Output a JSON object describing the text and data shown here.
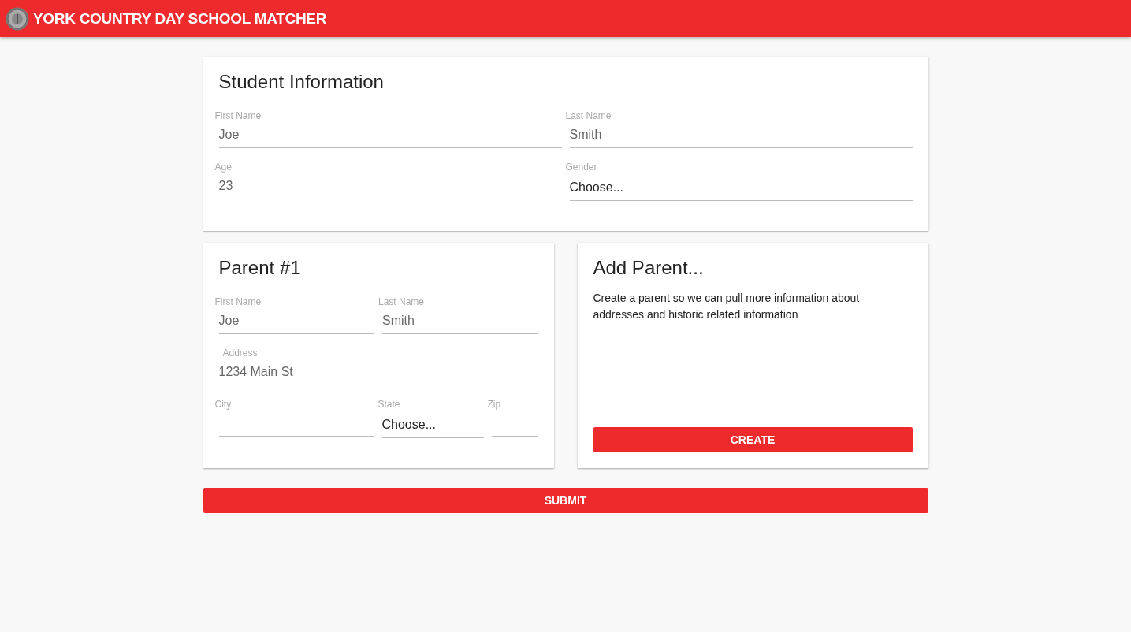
{
  "app_bar": {
    "title": "YORK COUNTRY DAY SCHOOL MATCHER"
  },
  "student": {
    "title": "Student Information",
    "rows": [
      [
        {
          "kind": "text",
          "label": "First Name",
          "value": "Joe"
        },
        {
          "kind": "text",
          "label": "Last Name",
          "value": "Smith"
        }
      ],
      [
        {
          "kind": "text",
          "label": "Age",
          "value": "23"
        },
        {
          "kind": "select",
          "label": "Gender",
          "value": "Choose..."
        }
      ]
    ]
  },
  "parent": {
    "title": "Parent #1",
    "rows": [
      [
        {
          "kind": "text",
          "label": "First Name",
          "value": "Joe"
        },
        {
          "kind": "text",
          "label": "Last Name",
          "value": "Smith"
        }
      ],
      [
        {
          "kind": "text",
          "label": "Address",
          "value": "1234 Main St"
        }
      ],
      [
        {
          "kind": "text",
          "label": "City"
        },
        {
          "kind": "select",
          "label": "State",
          "value": "Choose..."
        },
        {
          "kind": "text",
          "label": "Zip"
        }
      ]
    ]
  },
  "add_parent": {
    "title": "Add Parent...",
    "text": "Create a parent so we can pull more information about addresses and historic related information",
    "button": "CREATE"
  },
  "submit": "SUBMIT"
}
